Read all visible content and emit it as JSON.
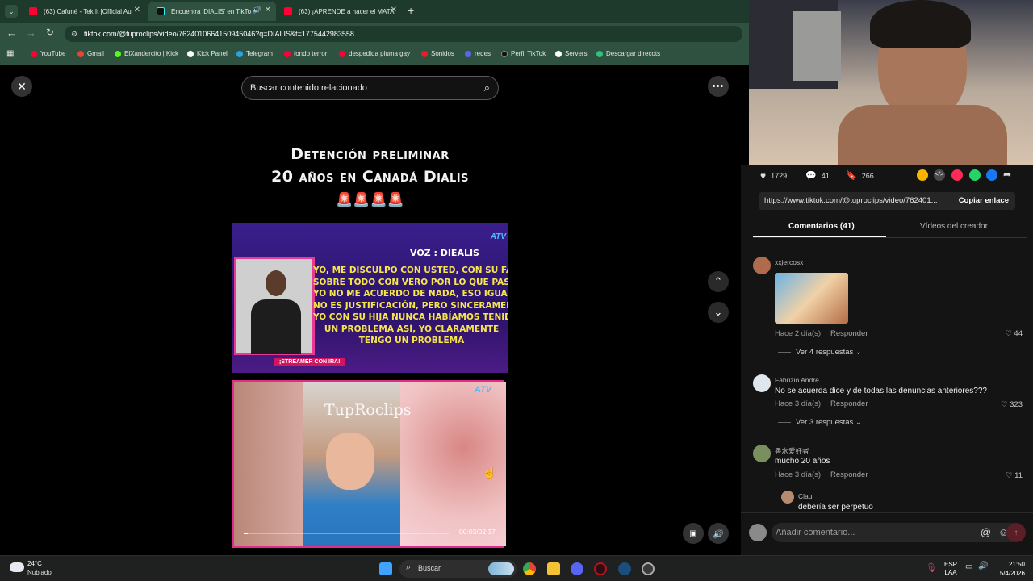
{
  "browser": {
    "tabs": [
      {
        "label": "(63) Cafuné - Tek It [Official Au",
        "icon": "youtube-icon",
        "color": "#ff0033"
      },
      {
        "label": "Encuentra 'DIALIS' en TikTo",
        "icon": "tiktok-icon",
        "color": "#111111"
      },
      {
        "label": "(63) ¡APRENDE a hacer el MATA",
        "icon": "youtube-icon",
        "color": "#ff0033"
      }
    ],
    "url": "tiktok.com/@tuproclips/video/7624010664150945046?q=DIALIS&t=1775442983558",
    "bookmarks": [
      {
        "label": "YouTube",
        "color": "#ff0033"
      },
      {
        "label": "Gmail",
        "color": "#ea4335"
      },
      {
        "label": "ElXandercito | Kick",
        "color": "#53fc18"
      },
      {
        "label": "Kick Panel",
        "color": "#ffffff"
      },
      {
        "label": "Telegram",
        "color": "#2aa3df"
      },
      {
        "label": "fondo terror",
        "color": "#ff0033"
      },
      {
        "label": "despedida pluma gay",
        "color": "#ff0033"
      },
      {
        "label": "Sonidos",
        "color": "#e81c2a"
      },
      {
        "label": "redes",
        "color": "#5865f2"
      },
      {
        "label": "Perfil TikTok",
        "color": "#111111"
      },
      {
        "label": "Servers",
        "color": "#ffffff"
      },
      {
        "label": "Descargar direcots",
        "color": "#2ec27e"
      }
    ]
  },
  "video": {
    "search_placeholder": "Buscar contenido relacionado",
    "title_line1": "Detención preliminar",
    "title_line2": "20 años en Canadá Dialis",
    "alarm_emojis": "🚨🚨🚨🚨",
    "voz_label": "VOZ : DIEALIS",
    "quote_lines": [
      "YO, ME DISCULPO CON USTED, CON SU FAMI",
      "SOBRE TODO CON VERO POR LO QUE PASÓ",
      "YO NO ME ACUERDO DE NADA, ESO IGUAL",
      "NO ES JUSTIFICACIÓN, PERO SINCERAMENT",
      "YO CON SU HIJA NUNCA HABÍAMOS TENID",
      "UN PROBLEMA ASÍ, YO CLARAMENTE",
      "TENGO UN PROBLEMA"
    ],
    "streamer_banner": "¡STREAMER CON IRA!",
    "watermark": "TupRoclips",
    "time": "00:03/02:37",
    "progress": 0.019
  },
  "stats": {
    "likes": "1729",
    "comments": "41",
    "saves": "266"
  },
  "share_colors": [
    "#f7b500",
    "#4a4a4a",
    "#fe2c55",
    "#25d366",
    "#1877f2"
  ],
  "link": {
    "url": "https://www.tiktok.com/@tuproclips/video/762401...",
    "copy_label": "Copiar enlace"
  },
  "panel_tabs": {
    "comments": "Comentarios (41)",
    "creator_videos": "Vídeos del creador"
  },
  "comments": [
    {
      "user": "xxjercosx",
      "text": "",
      "meta": "Hace 2 día(s)",
      "reply": "Responder",
      "likes": "44",
      "more": "Ver 4 respuestas"
    },
    {
      "user": "Fabrizio Andre",
      "text": "No se acuerda dice y de todas las denuncias anteriores???",
      "meta": "Hace 3 día(s)",
      "reply": "Responder",
      "likes": "323",
      "more": "Ver 3 respuestas"
    },
    {
      "user": "香水爱好者",
      "text": "mucho 20 años",
      "meta": "Hace 3 día(s)",
      "reply": "Responder",
      "likes": "11",
      "more": ""
    }
  ],
  "reply_preview": {
    "user": "Clau",
    "text": "debería ser perpetuo"
  },
  "comment_input_placeholder": "Añadir comentario...",
  "taskbar": {
    "weather_temp": "24°C",
    "weather_desc": "Nublado",
    "search_label": "Buscar",
    "lang_line1": "ESP",
    "lang_line2": "LAA",
    "time": "21:50",
    "date": "5/4/2026"
  }
}
